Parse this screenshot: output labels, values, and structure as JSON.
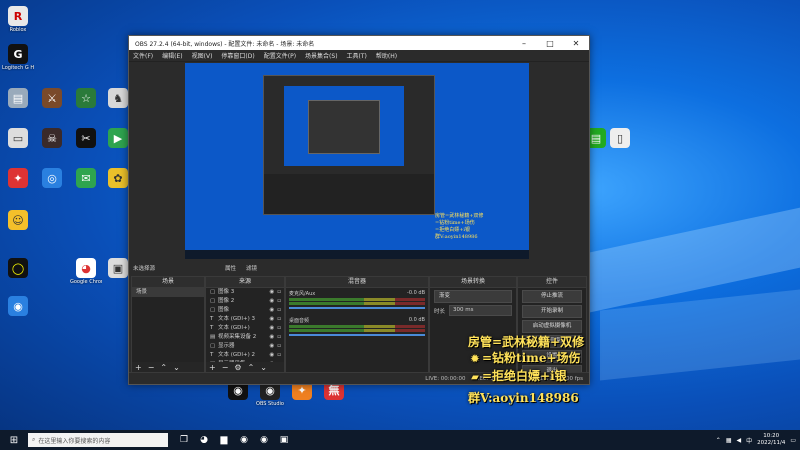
{
  "desktop": {
    "icons": [
      {
        "label": "Roblox",
        "glyph": "R",
        "bg": "#e8e8e8",
        "fg": "#c00"
      },
      {
        "label": "Logitech G HUB",
        "glyph": "G",
        "bg": "#111",
        "fg": "#fff"
      },
      {
        "label": "",
        "glyph": "▤",
        "bg": "#9ab",
        "fg": "#fff"
      },
      {
        "label": "",
        "glyph": "⚔",
        "bg": "#7a4a2a",
        "fg": "#fff"
      },
      {
        "label": "",
        "glyph": "☆",
        "bg": "#2a7a3a",
        "fg": "#fff"
      },
      {
        "label": "",
        "glyph": "♞",
        "bg": "#d8d8d8",
        "fg": "#333"
      },
      {
        "label": "",
        "glyph": "▭",
        "bg": "#ddd",
        "fg": "#333"
      },
      {
        "label": "",
        "glyph": "☠",
        "bg": "#3a2a2a",
        "fg": "#fff"
      },
      {
        "label": "",
        "glyph": "✂",
        "bg": "#111",
        "fg": "#fff"
      },
      {
        "label": "",
        "glyph": "▶",
        "bg": "#2ea44f",
        "fg": "#fff"
      },
      {
        "label": "",
        "glyph": "✦",
        "bg": "#d33",
        "fg": "#fff"
      },
      {
        "label": "",
        "glyph": "◎",
        "bg": "#2a80e0",
        "fg": "#fff"
      },
      {
        "label": "",
        "glyph": "✉",
        "bg": "#2ea44f",
        "fg": "#fff"
      },
      {
        "label": "",
        "glyph": "✿",
        "bg": "#eac02a",
        "fg": "#333"
      },
      {
        "label": "",
        "glyph": "☺",
        "bg": "#f4c02a",
        "fg": "#333"
      },
      {
        "label": "",
        "glyph": "◯",
        "bg": "#111",
        "fg": "#ff0"
      },
      {
        "label": "",
        "glyph": "◉",
        "bg": "#2a80e0",
        "fg": "#fff"
      },
      {
        "label": "Google Chrome",
        "glyph": "◕",
        "bg": "#fff",
        "fg": "#d33"
      },
      {
        "label": "",
        "glyph": "▣",
        "bg": "#ddd",
        "fg": "#333"
      },
      {
        "label": "",
        "glyph": "◐",
        "bg": "#dde",
        "fg": "#333"
      },
      {
        "label": "",
        "glyph": "🗑",
        "bg": "transparent",
        "fg": "#fff"
      }
    ],
    "right_icons": [
      {
        "label": "",
        "glyph": "▤",
        "bg": "#2a2",
        "fg": "#fff"
      },
      {
        "label": "",
        "glyph": "▯",
        "bg": "#eee",
        "fg": "#333"
      }
    ],
    "bottom_icons": [
      {
        "label": "",
        "glyph": "◉",
        "bg": "#111",
        "fg": "#fff"
      },
      {
        "label": "OBS Studio",
        "glyph": "◉",
        "bg": "#222",
        "fg": "#fff"
      },
      {
        "label": "",
        "glyph": "✦",
        "bg": "#f08020",
        "fg": "#fff"
      },
      {
        "label": "",
        "glyph": "無",
        "bg": "#d33",
        "fg": "#fff"
      }
    ]
  },
  "obs": {
    "title": "OBS 27.2.4 (64-bit, windows) - 配置文件: 未命名 - 场景: 未命名",
    "menu": [
      "文件(F)",
      "编辑(E)",
      "视图(V)",
      "停靠窗口(D)",
      "配置文件(P)",
      "场景集合(S)",
      "工具(T)",
      "帮助(H)"
    ],
    "toolbar": {
      "scene_label": "未选择源",
      "props": "属性",
      "filters": "滤镜"
    },
    "scenes": {
      "header": "场景",
      "items": [
        "场景"
      ]
    },
    "sources": {
      "header": "来源",
      "items": [
        {
          "icon": "▢",
          "name": "图像 3"
        },
        {
          "icon": "▢",
          "name": "图像 2"
        },
        {
          "icon": "▢",
          "name": "图像"
        },
        {
          "icon": "T",
          "name": "文本 (GDI+) 3"
        },
        {
          "icon": "T",
          "name": "文本 (GDI+)"
        },
        {
          "icon": "▤",
          "name": "视频采集设备 2"
        },
        {
          "icon": "▢",
          "name": "显示器"
        },
        {
          "icon": "T",
          "name": "文本 (GDI+) 2"
        },
        {
          "icon": "▤",
          "name": "显示器采集"
        }
      ]
    },
    "mixer": {
      "header": "混音器",
      "channels": [
        {
          "name": "麦克风/Aux",
          "db": "-0.0 dB"
        },
        {
          "name": "桌面音频",
          "db": "0.0 dB"
        }
      ]
    },
    "transitions": {
      "header": "场景转换",
      "type": "渐变",
      "duration_label": "时长",
      "duration": "300 ms"
    },
    "controls": {
      "header": "控件",
      "buttons": [
        "停止推流",
        "开始录制",
        "启动虚拟摄像机",
        "工作室模式",
        "设置",
        "退出"
      ]
    },
    "status": {
      "live": "LIVE: 00:00:00",
      "rec": "REC: 00:00:00",
      "cpu": "CPU: 1.2%, 60.00 fps"
    }
  },
  "overlay": {
    "lines": [
      {
        "emoji": "",
        "text": "房管=武林秘籍+双修"
      },
      {
        "emoji": "✹",
        "text": "=钻粉time+场伤"
      },
      {
        "emoji": "▰",
        "text": "=拒绝白嫖+i银"
      },
      {
        "emoji": "",
        "text": "群V:aoyin148986"
      }
    ]
  },
  "taskbar": {
    "search_placeholder": "在这里输入你要搜索的内容",
    "time": "10:20",
    "date": "2022/11/4"
  }
}
